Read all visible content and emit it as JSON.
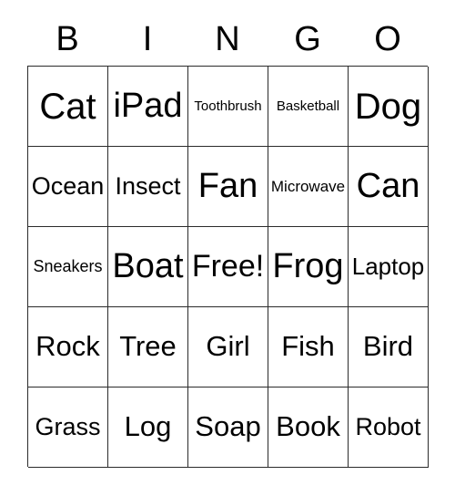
{
  "card": {
    "header_letters": [
      "B",
      "I",
      "N",
      "G",
      "O"
    ],
    "rows": [
      [
        {
          "label": "Cat",
          "size": "xl"
        },
        {
          "label": "iPad",
          "size": "lg"
        },
        {
          "label": "Toothbrush",
          "size": "tiny"
        },
        {
          "label": "Basketball",
          "size": "tiny"
        },
        {
          "label": "Dog",
          "size": "xl"
        }
      ],
      [
        {
          "label": "Ocean",
          "size": "sm"
        },
        {
          "label": "Insect",
          "size": "sm"
        },
        {
          "label": "Fan",
          "size": "lg"
        },
        {
          "label": "Microwave",
          "size": "xxs"
        },
        {
          "label": "Can",
          "size": "lg"
        }
      ],
      [
        {
          "label": "Sneakers",
          "size": "xxs"
        },
        {
          "label": "Boat",
          "size": "lg"
        },
        {
          "label": "Free!",
          "size": "lg"
        },
        {
          "label": "Frog",
          "size": "lg"
        },
        {
          "label": "Laptop",
          "size": "sm"
        }
      ],
      [
        {
          "label": "Rock",
          "size": "md"
        },
        {
          "label": "Tree",
          "size": "md"
        },
        {
          "label": "Girl",
          "size": "md"
        },
        {
          "label": "Fish",
          "size": "md"
        },
        {
          "label": "Bird",
          "size": "md"
        }
      ],
      [
        {
          "label": "Grass",
          "size": "sm"
        },
        {
          "label": "Log",
          "size": "md"
        },
        {
          "label": "Soap",
          "size": "md"
        },
        {
          "label": "Book",
          "size": "md"
        },
        {
          "label": "Robot",
          "size": "sm"
        }
      ]
    ],
    "colors": {
      "background": "#ffffff",
      "border": "#2b2b2b",
      "text": "#000000"
    }
  }
}
